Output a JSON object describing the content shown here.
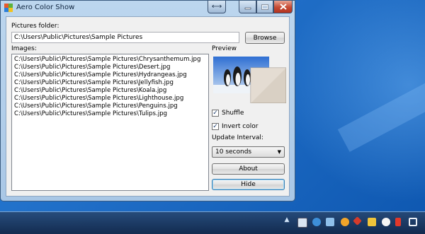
{
  "window": {
    "title": "Aero Color Show",
    "extra_button_glyph": "⟷",
    "minimize_glyph": "—",
    "maximize_glyph": "□",
    "close_glyph": "✕"
  },
  "folder": {
    "label": "Pictures folder:",
    "value": "C:\\Users\\Public\\Pictures\\Sample Pictures",
    "browse_label": "Browse"
  },
  "images": {
    "label": "Images:",
    "items": [
      "C:\\Users\\Public\\Pictures\\Sample Pictures\\Chrysanthemum.jpg",
      "C:\\Users\\Public\\Pictures\\Sample Pictures\\Desert.jpg",
      "C:\\Users\\Public\\Pictures\\Sample Pictures\\Hydrangeas.jpg",
      "C:\\Users\\Public\\Pictures\\Sample Pictures\\Jellyfish.jpg",
      "C:\\Users\\Public\\Pictures\\Sample Pictures\\Koala.jpg",
      "C:\\Users\\Public\\Pictures\\Sample Pictures\\Lighthouse.jpg",
      "C:\\Users\\Public\\Pictures\\Sample Pictures\\Penguins.jpg",
      "C:\\Users\\Public\\Pictures\\Sample Pictures\\Tulips.jpg"
    ]
  },
  "preview": {
    "label": "Preview",
    "icon": "penguins-thumbnail"
  },
  "options": {
    "shuffle_label": "Shuffle",
    "shuffle_checked": true,
    "invert_label": "Invert color",
    "invert_checked": true,
    "interval_label": "Update Interval:",
    "interval_value": "10 seconds"
  },
  "buttons": {
    "about_label": "About",
    "hide_label": "Hide"
  },
  "colors": {
    "client_bg": "#f0f0f0",
    "frame": "#bcd6ee",
    "close": "#c64a33",
    "desktop": "#1f6dc6"
  },
  "tray": {
    "icons": [
      "show-hidden-icons",
      "monitor-icon",
      "ie-icon",
      "network-icon",
      "messenger-icon",
      "antivirus-icon",
      "folder-icon",
      "chat-icon",
      "volume-icon",
      "display-icon"
    ]
  }
}
